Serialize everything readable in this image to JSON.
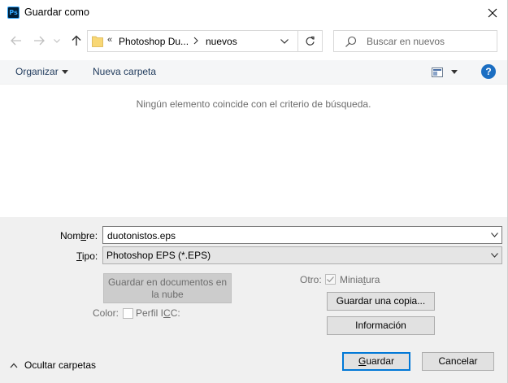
{
  "window": {
    "title": "Guardar como",
    "app_icon_text": "Ps"
  },
  "nav": {
    "breadcrumb_prefix": "«",
    "breadcrumb": [
      "Photoshop Du...",
      "nuevos"
    ],
    "search_placeholder": "Buscar en nuevos"
  },
  "toolbar": {
    "organize_label": "Organizar",
    "new_folder_label": "Nueva carpeta",
    "help_label": "?"
  },
  "file_list": {
    "empty_message": "Ningún elemento coincide con el criterio de búsqueda."
  },
  "form": {
    "name_label_pre": "Nom",
    "name_label_key": "b",
    "name_label_post": "re:",
    "name_value": "duotonistos.eps",
    "type_label_key": "T",
    "type_label_post": "ipo:",
    "type_value": "Photoshop EPS (*.EPS)",
    "cloud_button_label": "Guardar en documentos en la nube",
    "other_label": "Otro:",
    "thumbnail_label_pre": "Minia",
    "thumbnail_label_key": "t",
    "thumbnail_label_post": "ura",
    "thumbnail_checked": true,
    "color_label": "Color:",
    "icc_label_pre": "Perfil I",
    "icc_label_key": "C",
    "icc_label_post": "C:",
    "icc_checked": false,
    "save_copy_label": "Guardar una copia...",
    "info_label": "Información"
  },
  "footer": {
    "hide_folders_label": "Ocultar carpetas",
    "save_label_key": "G",
    "save_label_post": "uardar",
    "cancel_label": "Cancelar"
  },
  "colors": {
    "accent": "#0078d7",
    "help_blue": "#1b6ec2",
    "folder_yellow": "#f8d775"
  }
}
